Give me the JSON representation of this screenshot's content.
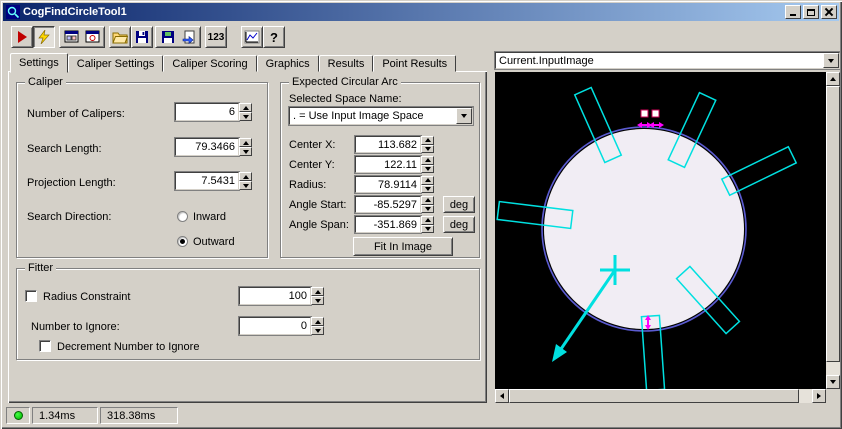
{
  "window": {
    "title": "CogFindCircleTool1"
  },
  "toolbar": {
    "number_button_label": "123",
    "help_label": "?"
  },
  "tabs": {
    "items": [
      "Settings",
      "Caliper Settings",
      "Caliper Scoring",
      "Graphics",
      "Results",
      "Point Results"
    ],
    "active": "Settings"
  },
  "caliper": {
    "title": "Caliper",
    "number_of_calipers": {
      "label": "Number of Calipers:",
      "value": "6"
    },
    "search_length": {
      "label": "Search Length:",
      "value": "79.3466"
    },
    "projection_length": {
      "label": "Projection Length:",
      "value": "7.5431"
    },
    "search_direction": {
      "label": "Search Direction:",
      "options": [
        "Inward",
        "Outward"
      ],
      "selected": "Outward"
    }
  },
  "arc": {
    "title": "Expected Circular Arc",
    "selected_space": {
      "label": "Selected Space Name:",
      "value": ". = Use Input Image Space"
    },
    "center_x": {
      "label": "Center X:",
      "value": "113.682"
    },
    "center_y": {
      "label": "Center Y:",
      "value": "122.11"
    },
    "radius": {
      "label": "Radius:",
      "value": "78.9114"
    },
    "angle_start": {
      "label": "Angle Start:",
      "value": "-85.5297",
      "unit": "deg"
    },
    "angle_span": {
      "label": "Angle Span:",
      "value": "-351.869",
      "unit": "deg"
    },
    "fit_button_label": "Fit In Image"
  },
  "fitter": {
    "title": "Fitter",
    "radius_constraint": {
      "label": "Radius Constraint",
      "value": "100",
      "checked": false
    },
    "number_to_ignore": {
      "label": "Number to Ignore:",
      "value": "0"
    },
    "decrement": {
      "label": "Decrement Number to Ignore",
      "checked": false
    }
  },
  "image_panel": {
    "source": "Current.InputImage"
  },
  "statusbar": {
    "time1": "1.34ms",
    "time2": "318.38ms"
  },
  "colors": {
    "caliper_cyan": "#00e0e0",
    "marker_magenta": "#ff00ff",
    "ring_blue": "#5b5bd0",
    "led_green": "#00c400",
    "titlebar_left": "#0a246a",
    "titlebar_right": "#a6caf0"
  }
}
